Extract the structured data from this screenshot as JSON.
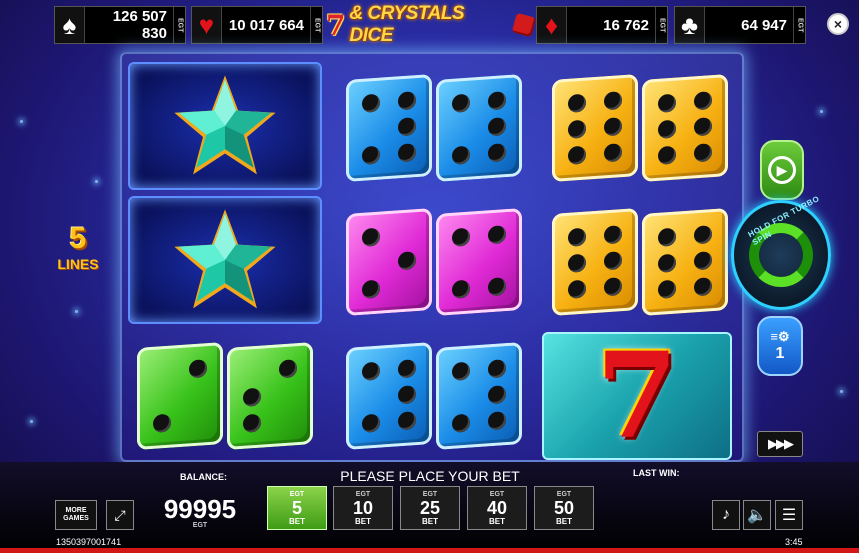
{
  "jackpots": [
    {
      "suit": "spades",
      "suit_glyph": "♠",
      "value": "126 507 830",
      "brand": "EGT"
    },
    {
      "suit": "hearts",
      "suit_glyph": "♥",
      "value": "10 017 664",
      "brand": "EGT"
    },
    {
      "suit": "diamonds",
      "suit_glyph": "♦",
      "value": "16 762",
      "brand": "EGT"
    },
    {
      "suit": "clubs",
      "suit_glyph": "♣",
      "value": "64 947",
      "brand": "EGT"
    }
  ],
  "logo": {
    "seven": "7",
    "text": "& CRYSTALS DICE"
  },
  "close_glyph": "×",
  "lines": {
    "count": "5",
    "label": "LINES"
  },
  "reels": [
    [
      "star",
      "star",
      "green-dice"
    ],
    [
      "blue-dice",
      "pink-dice",
      "blue-dice"
    ],
    [
      "yellow-dice",
      "yellow-dice",
      "seven"
    ]
  ],
  "seven_symbol": "7",
  "controls": {
    "autoplay_glyph": "▶",
    "spin_hold_text": "HOLD FOR TURBO SPIN",
    "lines_button_icon": "≡⚙",
    "lines_button_value": "1",
    "turbo_glyph": "▶▶▶"
  },
  "panel": {
    "balance_label": "BALANCE:",
    "balance_value": "99995",
    "balance_brand": "EGT",
    "message": "PLEASE PLACE YOUR BET",
    "last_win_label": "LAST WIN:",
    "more_games": "MORE GAMES",
    "fullscreen_glyph": "⤢",
    "bets": [
      {
        "brand": "EGT",
        "value": "5",
        "label": "BET",
        "selected": true
      },
      {
        "brand": "EGT",
        "value": "10",
        "label": "BET",
        "selected": false
      },
      {
        "brand": "EGT",
        "value": "25",
        "label": "BET",
        "selected": false
      },
      {
        "brand": "EGT",
        "value": "40",
        "label": "BET",
        "selected": false
      },
      {
        "brand": "EGT",
        "value": "50",
        "label": "BET",
        "selected": false
      }
    ],
    "music_glyph": "♪",
    "sound_glyph": "🔈",
    "menu_glyph": "☰",
    "ticket_id": "1350397001741",
    "clock": "3:45"
  },
  "colors": {
    "selected_bet": "#5bb520",
    "jackpot_bg": "#000000",
    "red_line": "#d21717"
  }
}
